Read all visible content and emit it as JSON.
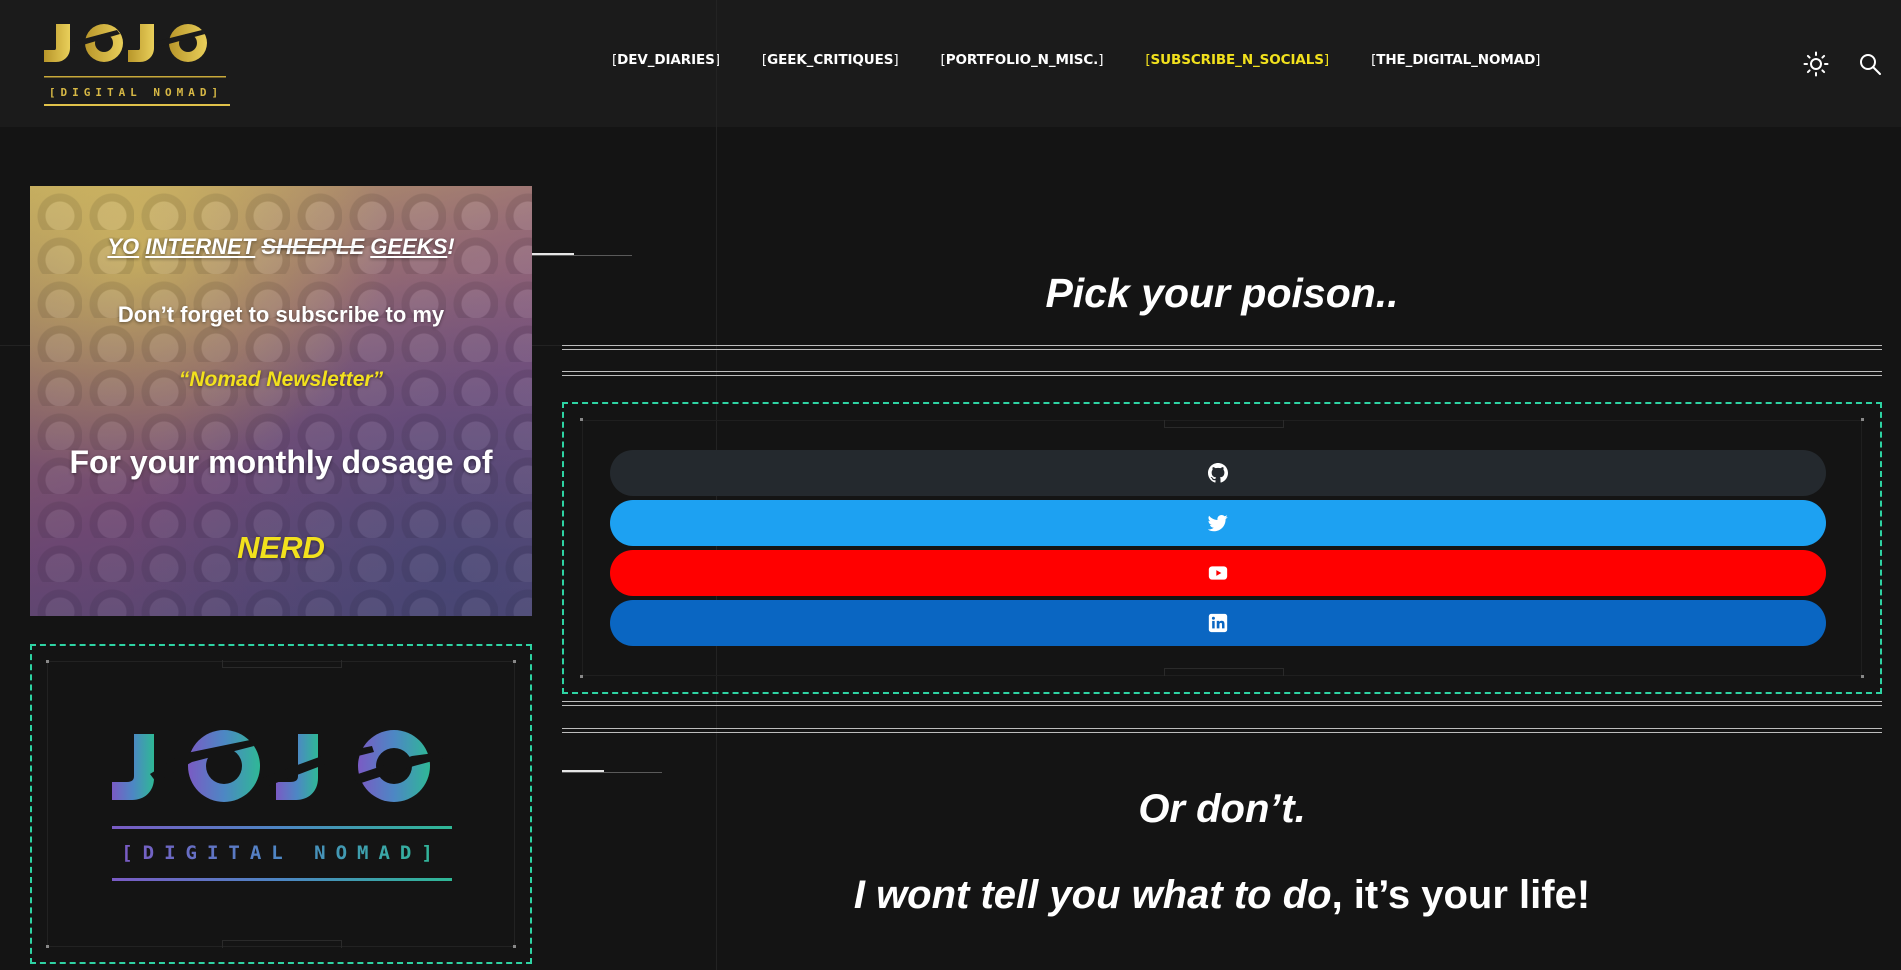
{
  "header": {
    "logo_alt": "JOJO [DIGITAL NOMAD]",
    "nav": [
      {
        "label": "DEV_DIARIES",
        "active": false
      },
      {
        "label": "GEEK_CRITIQUES",
        "active": false
      },
      {
        "label": "PORTFOLIO_N_MISC.",
        "active": false
      },
      {
        "label": "SUBSCRIBE_N_SOCIALS",
        "active": true
      },
      {
        "label": "THE_DIGITAL_NOMAD",
        "active": false
      }
    ],
    "icons": [
      "sun-icon",
      "search-icon"
    ]
  },
  "promo": {
    "line1_parts": [
      "YO",
      "INTERNET",
      "SHEEPLE",
      "GEEKS",
      "!"
    ],
    "line2": "Don’t forget to subscribe to my",
    "line3": "“Nomad Newsletter”",
    "line4": "For your monthly dosage of",
    "line5": "NERD"
  },
  "logo_card": {
    "title": "JOJO",
    "subtitle": "[DIGITAL NOMAD]"
  },
  "main": {
    "heading": "Pick your poison..",
    "socials": [
      {
        "name": "github",
        "icon": "github-icon",
        "color": "#24292e"
      },
      {
        "name": "twitter",
        "icon": "twitter-icon",
        "color": "#1da1f2"
      },
      {
        "name": "youtube",
        "icon": "youtube-icon",
        "color": "#ff0000"
      },
      {
        "name": "linkedin",
        "icon": "linkedin-icon",
        "color": "#0a66c2"
      }
    ],
    "outro1": "Or don’t.",
    "outro2_italic": "I wont tell you what to do",
    "outro2_rest": ", it’s your life!"
  },
  "colors": {
    "accent_yellow": "#f2e11d",
    "frame_green": "#2ed3a3",
    "background": "#141414",
    "header_bg": "#1b1b1b"
  }
}
